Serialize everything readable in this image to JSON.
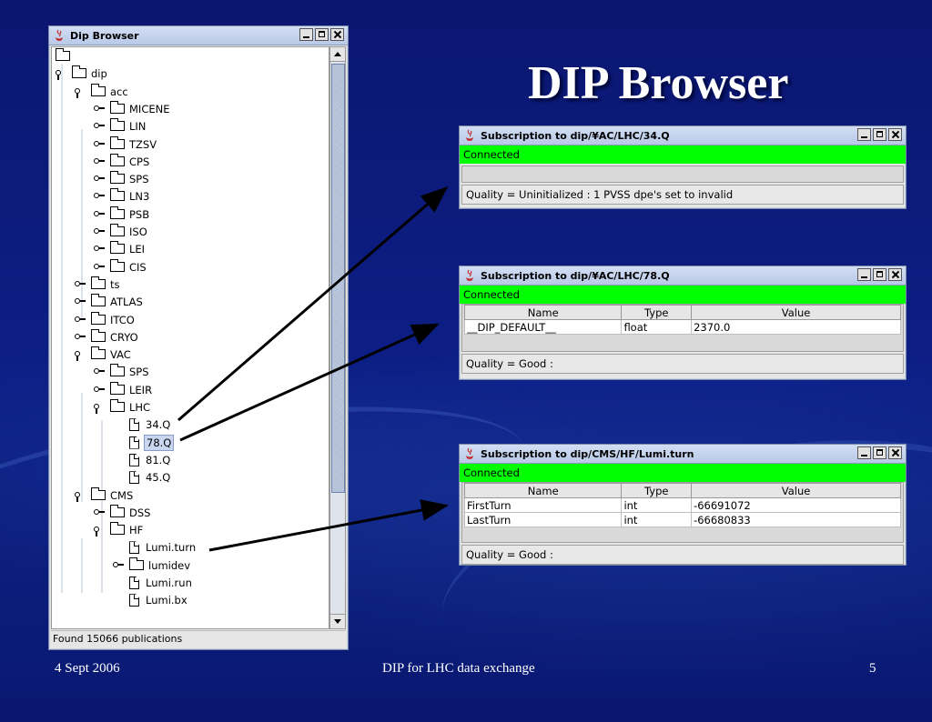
{
  "slide": {
    "title": "DIP Browser",
    "footer_left": "4 Sept 2006",
    "footer_center": "DIP for LHC data exchange",
    "footer_right": "5"
  },
  "browser": {
    "title": "Dip Browser",
    "status": "Found 15066 publications",
    "tree": [
      {
        "label": "",
        "kind": "folder",
        "level": 0,
        "handle": "none"
      },
      {
        "label": "dip",
        "kind": "folder",
        "level": 0,
        "handle": "expanded"
      },
      {
        "label": "acc",
        "kind": "folder",
        "level": 1,
        "handle": "expanded"
      },
      {
        "label": "MICENE",
        "kind": "folder",
        "level": 2,
        "handle": "collapsed"
      },
      {
        "label": "LIN",
        "kind": "folder",
        "level": 2,
        "handle": "collapsed"
      },
      {
        "label": "TZSV",
        "kind": "folder",
        "level": 2,
        "handle": "collapsed"
      },
      {
        "label": "CPS",
        "kind": "folder",
        "level": 2,
        "handle": "collapsed"
      },
      {
        "label": "SPS",
        "kind": "folder",
        "level": 2,
        "handle": "collapsed"
      },
      {
        "label": "LN3",
        "kind": "folder",
        "level": 2,
        "handle": "collapsed"
      },
      {
        "label": "PSB",
        "kind": "folder",
        "level": 2,
        "handle": "collapsed"
      },
      {
        "label": "ISO",
        "kind": "folder",
        "level": 2,
        "handle": "collapsed"
      },
      {
        "label": "LEI",
        "kind": "folder",
        "level": 2,
        "handle": "collapsed"
      },
      {
        "label": "CIS",
        "kind": "folder",
        "level": 2,
        "handle": "collapsed"
      },
      {
        "label": "ts",
        "kind": "folder",
        "level": 1,
        "handle": "collapsed"
      },
      {
        "label": "ATLAS",
        "kind": "folder",
        "level": 1,
        "handle": "collapsed"
      },
      {
        "label": "ITCO",
        "kind": "folder",
        "level": 1,
        "handle": "collapsed"
      },
      {
        "label": "CRYO",
        "kind": "folder",
        "level": 1,
        "handle": "collapsed"
      },
      {
        "label": "VAC",
        "kind": "folder",
        "level": 1,
        "handle": "expanded"
      },
      {
        "label": "SPS",
        "kind": "folder",
        "level": 2,
        "handle": "collapsed"
      },
      {
        "label": "LEIR",
        "kind": "folder",
        "level": 2,
        "handle": "collapsed"
      },
      {
        "label": "LHC",
        "kind": "folder",
        "level": 2,
        "handle": "expanded"
      },
      {
        "label": "34.Q",
        "kind": "file",
        "level": 3,
        "handle": "none"
      },
      {
        "label": "78.Q",
        "kind": "file",
        "level": 3,
        "handle": "none",
        "selected": true
      },
      {
        "label": "81.Q",
        "kind": "file",
        "level": 3,
        "handle": "none"
      },
      {
        "label": "45.Q",
        "kind": "file",
        "level": 3,
        "handle": "none"
      },
      {
        "label": "CMS",
        "kind": "folder",
        "level": 1,
        "handle": "expanded"
      },
      {
        "label": "DSS",
        "kind": "folder",
        "level": 2,
        "handle": "collapsed"
      },
      {
        "label": "HF",
        "kind": "folder",
        "level": 2,
        "handle": "expanded"
      },
      {
        "label": "Lumi.turn",
        "kind": "file",
        "level": 3,
        "handle": "none"
      },
      {
        "label": "lumidev",
        "kind": "folder",
        "level": 3,
        "handle": "collapsed"
      },
      {
        "label": "Lumi.run",
        "kind": "file",
        "level": 3,
        "handle": "none"
      },
      {
        "label": "Lumi.bx",
        "kind": "file",
        "level": 3,
        "handle": "none"
      }
    ]
  },
  "sub1": {
    "title": "Subscription to dip/¥AC/LHC/34.Q",
    "connection": "Connected",
    "quality": "Quality = Uninitialized : 1 PVSS dpe's set to invalid"
  },
  "sub2": {
    "title": "Subscription to dip/¥AC/LHC/78.Q",
    "connection": "Connected",
    "columns": [
      "Name",
      "Type",
      "Value"
    ],
    "rows": [
      [
        "__DIP_DEFAULT__",
        "float",
        "2370.0"
      ]
    ],
    "quality": "Quality = Good :"
  },
  "sub3": {
    "title": "Subscription to dip/CMS/HF/Lumi.turn",
    "connection": "Connected",
    "columns": [
      "Name",
      "Type",
      "Value"
    ],
    "rows": [
      [
        "FirstTurn",
        "int",
        "-66691072"
      ],
      [
        "LastTurn",
        "int",
        "-66680833"
      ]
    ],
    "quality": "Quality = Good :"
  },
  "colors": {
    "background": "#0c1f86",
    "connected": "#00ff00",
    "title_text": "#ffffff"
  }
}
